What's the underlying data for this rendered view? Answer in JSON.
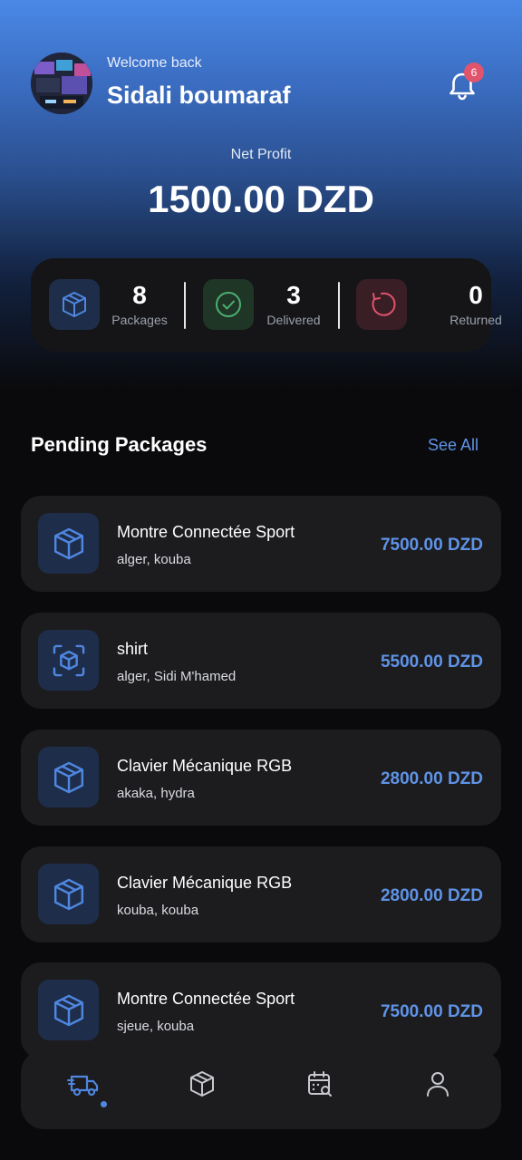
{
  "header": {
    "welcome": "Welcome back",
    "username": "Sidali boumaraf",
    "notification_count": "6"
  },
  "summary": {
    "label": "Net Profit",
    "value": "1500.00 DZD"
  },
  "stats": [
    {
      "value": "8",
      "label": "Packages",
      "icon": "package-icon",
      "color": "#4f86e0"
    },
    {
      "value": "3",
      "label": "Delivered",
      "icon": "check-circle-icon",
      "color": "#4caf72"
    },
    {
      "value": "0",
      "label": "Returned",
      "icon": "return-icon",
      "color": "#e0546c"
    }
  ],
  "pending": {
    "title": "Pending Packages",
    "see_all": "See All",
    "items": [
      {
        "name": "Montre Connectée Sport",
        "location": "alger, kouba",
        "price": "7500.00 DZD",
        "icon": "package-icon"
      },
      {
        "name": "shirt",
        "location": "alger, Sidi M'hamed",
        "price": "5500.00 DZD",
        "icon": "package-scan-icon"
      },
      {
        "name": "Clavier Mécanique RGB",
        "location": "akaka, hydra",
        "price": "2800.00 DZD",
        "icon": "package-icon"
      },
      {
        "name": "Clavier Mécanique RGB",
        "location": "kouba, kouba",
        "price": "2800.00 DZD",
        "icon": "package-icon"
      },
      {
        "name": "Montre Connectée Sport",
        "location": "sjeue, kouba",
        "price": "7500.00 DZD",
        "icon": "package-icon"
      }
    ]
  },
  "nav": {
    "items": [
      {
        "icon": "delivery-truck-icon",
        "active": true
      },
      {
        "icon": "package-icon",
        "active": false
      },
      {
        "icon": "calendar-search-icon",
        "active": false
      },
      {
        "icon": "user-icon",
        "active": false
      }
    ]
  },
  "colors": {
    "accent": "#5f93e6",
    "badge": "#e0546c",
    "card_bg": "#1c1c1f",
    "gradient_top": "#4a88e6"
  }
}
